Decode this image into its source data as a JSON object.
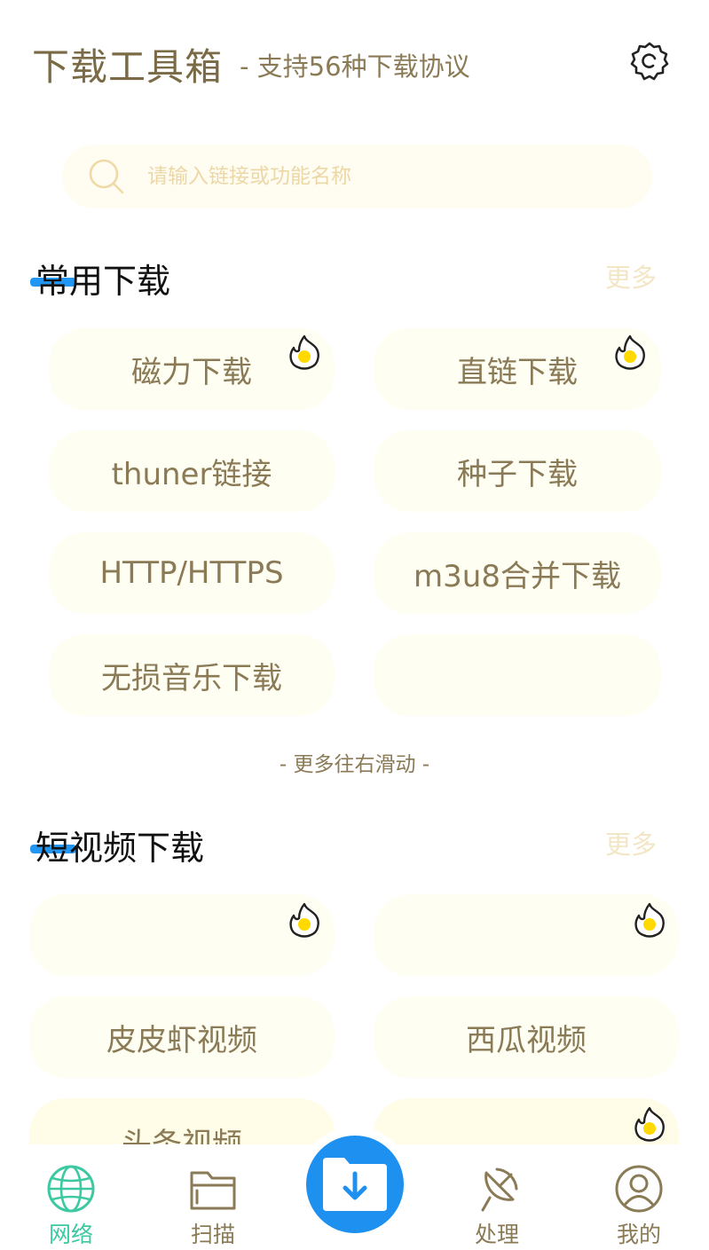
{
  "header": {
    "title": "下载工具箱",
    "subtitle": "- 支持56种下载协议",
    "settings_icon": "gear-icon"
  },
  "search": {
    "placeholder": "请输入链接或功能名称",
    "icon": "search-icon"
  },
  "sections": {
    "common": {
      "title": "常用下载",
      "more": "更多",
      "items": [
        {
          "label": "磁力下载",
          "hot": true
        },
        {
          "label": "直链下载",
          "hot": true
        },
        {
          "label": "thuner链接",
          "hot": false
        },
        {
          "label": "种子下载",
          "hot": false
        },
        {
          "label": "HTTP/HTTPS",
          "hot": false
        },
        {
          "label": "m3u8合并下载",
          "hot": false
        },
        {
          "label": "无损音乐下载",
          "hot": false
        },
        {
          "label": "",
          "hot": false
        }
      ],
      "hint": "- 更多往右滑动 -"
    },
    "short_video": {
      "title": "短视频下载",
      "more": "更多",
      "items": [
        {
          "label": "",
          "hot": true
        },
        {
          "label": "",
          "hot": true
        },
        {
          "label": "皮皮虾视频",
          "hot": false
        },
        {
          "label": "西瓜视频",
          "hot": false
        },
        {
          "label": "头条视频",
          "hot": false
        },
        {
          "label": "",
          "hot": true
        }
      ]
    }
  },
  "bottom_nav": {
    "items": [
      {
        "label": "网络",
        "icon": "globe-icon",
        "active": true
      },
      {
        "label": "扫描",
        "icon": "folder-icon",
        "active": false
      },
      {
        "label": "处理",
        "icon": "satellite-dish-icon",
        "active": false
      },
      {
        "label": "我的",
        "icon": "user-icon",
        "active": false
      }
    ],
    "center_icon": "download-folder-icon"
  },
  "colors": {
    "accent_blue": "#1e90ef",
    "active_green": "#3cc8a0",
    "text_brown": "#8a7a55",
    "card_bg": "#fffef3",
    "hot_yellow": "#ffd900"
  }
}
